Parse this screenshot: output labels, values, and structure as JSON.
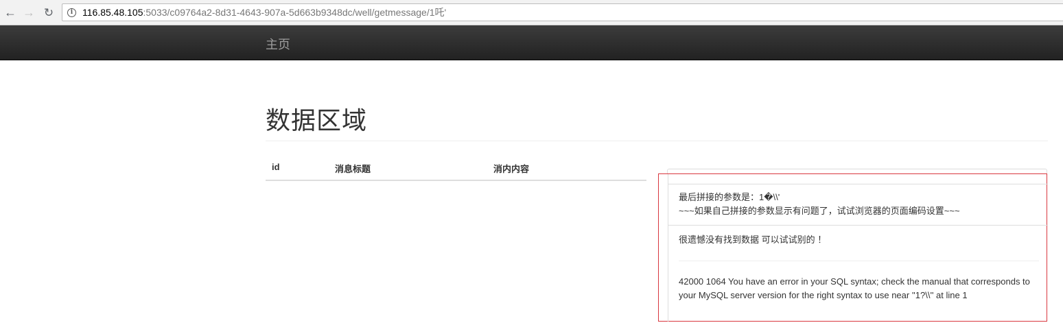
{
  "browser": {
    "url_host": "116.85.48.105",
    "url_rest": ":5033/c09764a2-8d31-4643-907a-5d663b9348dc/well/getmessage/1吒'",
    "back_icon": "arrow-left-icon",
    "forward_icon": "arrow-right-icon",
    "reload_icon": "reload-icon",
    "info_icon": "info-icon"
  },
  "navbar": {
    "brand": "主页"
  },
  "page": {
    "title": "数据区域"
  },
  "table": {
    "columns": [
      "id",
      "消息标题",
      "消内内容"
    ],
    "rows": []
  },
  "panel": {
    "param_label": "最后拼接的参数是：1�\\\\'",
    "hint": "~~~如果自己拼接的参数显示有问题了，试试浏览器的页面编码设置~~~",
    "no_data": "很遗憾没有找到数据 可以试试别的 ！",
    "error": "42000 1064 You have an error in your SQL syntax; check the manual that corresponds to your MySQL server version for the right syntax to use near ''1?\\\\'' at line 1"
  },
  "colors": {
    "navbar": "#222222",
    "highlight_border": "#d9363e"
  }
}
